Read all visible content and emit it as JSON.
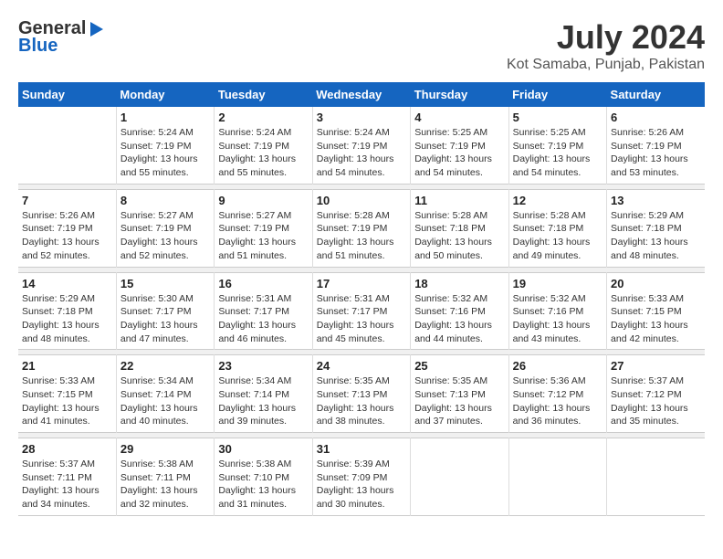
{
  "header": {
    "logo_general": "General",
    "logo_blue": "Blue",
    "title": "July 2024",
    "location": "Kot Samaba, Punjab, Pakistan"
  },
  "weekdays": [
    "Sunday",
    "Monday",
    "Tuesday",
    "Wednesday",
    "Thursday",
    "Friday",
    "Saturday"
  ],
  "weeks": [
    [
      {
        "day": "",
        "info": ""
      },
      {
        "day": "1",
        "info": "Sunrise: 5:24 AM\nSunset: 7:19 PM\nDaylight: 13 hours\nand 55 minutes."
      },
      {
        "day": "2",
        "info": "Sunrise: 5:24 AM\nSunset: 7:19 PM\nDaylight: 13 hours\nand 55 minutes."
      },
      {
        "day": "3",
        "info": "Sunrise: 5:24 AM\nSunset: 7:19 PM\nDaylight: 13 hours\nand 54 minutes."
      },
      {
        "day": "4",
        "info": "Sunrise: 5:25 AM\nSunset: 7:19 PM\nDaylight: 13 hours\nand 54 minutes."
      },
      {
        "day": "5",
        "info": "Sunrise: 5:25 AM\nSunset: 7:19 PM\nDaylight: 13 hours\nand 54 minutes."
      },
      {
        "day": "6",
        "info": "Sunrise: 5:26 AM\nSunset: 7:19 PM\nDaylight: 13 hours\nand 53 minutes."
      }
    ],
    [
      {
        "day": "7",
        "info": "Sunrise: 5:26 AM\nSunset: 7:19 PM\nDaylight: 13 hours\nand 52 minutes."
      },
      {
        "day": "8",
        "info": "Sunrise: 5:27 AM\nSunset: 7:19 PM\nDaylight: 13 hours\nand 52 minutes."
      },
      {
        "day": "9",
        "info": "Sunrise: 5:27 AM\nSunset: 7:19 PM\nDaylight: 13 hours\nand 51 minutes."
      },
      {
        "day": "10",
        "info": "Sunrise: 5:28 AM\nSunset: 7:19 PM\nDaylight: 13 hours\nand 51 minutes."
      },
      {
        "day": "11",
        "info": "Sunrise: 5:28 AM\nSunset: 7:18 PM\nDaylight: 13 hours\nand 50 minutes."
      },
      {
        "day": "12",
        "info": "Sunrise: 5:28 AM\nSunset: 7:18 PM\nDaylight: 13 hours\nand 49 minutes."
      },
      {
        "day": "13",
        "info": "Sunrise: 5:29 AM\nSunset: 7:18 PM\nDaylight: 13 hours\nand 48 minutes."
      }
    ],
    [
      {
        "day": "14",
        "info": "Sunrise: 5:29 AM\nSunset: 7:18 PM\nDaylight: 13 hours\nand 48 minutes."
      },
      {
        "day": "15",
        "info": "Sunrise: 5:30 AM\nSunset: 7:17 PM\nDaylight: 13 hours\nand 47 minutes."
      },
      {
        "day": "16",
        "info": "Sunrise: 5:31 AM\nSunset: 7:17 PM\nDaylight: 13 hours\nand 46 minutes."
      },
      {
        "day": "17",
        "info": "Sunrise: 5:31 AM\nSunset: 7:17 PM\nDaylight: 13 hours\nand 45 minutes."
      },
      {
        "day": "18",
        "info": "Sunrise: 5:32 AM\nSunset: 7:16 PM\nDaylight: 13 hours\nand 44 minutes."
      },
      {
        "day": "19",
        "info": "Sunrise: 5:32 AM\nSunset: 7:16 PM\nDaylight: 13 hours\nand 43 minutes."
      },
      {
        "day": "20",
        "info": "Sunrise: 5:33 AM\nSunset: 7:15 PM\nDaylight: 13 hours\nand 42 minutes."
      }
    ],
    [
      {
        "day": "21",
        "info": "Sunrise: 5:33 AM\nSunset: 7:15 PM\nDaylight: 13 hours\nand 41 minutes."
      },
      {
        "day": "22",
        "info": "Sunrise: 5:34 AM\nSunset: 7:14 PM\nDaylight: 13 hours\nand 40 minutes."
      },
      {
        "day": "23",
        "info": "Sunrise: 5:34 AM\nSunset: 7:14 PM\nDaylight: 13 hours\nand 39 minutes."
      },
      {
        "day": "24",
        "info": "Sunrise: 5:35 AM\nSunset: 7:13 PM\nDaylight: 13 hours\nand 38 minutes."
      },
      {
        "day": "25",
        "info": "Sunrise: 5:35 AM\nSunset: 7:13 PM\nDaylight: 13 hours\nand 37 minutes."
      },
      {
        "day": "26",
        "info": "Sunrise: 5:36 AM\nSunset: 7:12 PM\nDaylight: 13 hours\nand 36 minutes."
      },
      {
        "day": "27",
        "info": "Sunrise: 5:37 AM\nSunset: 7:12 PM\nDaylight: 13 hours\nand 35 minutes."
      }
    ],
    [
      {
        "day": "28",
        "info": "Sunrise: 5:37 AM\nSunset: 7:11 PM\nDaylight: 13 hours\nand 34 minutes."
      },
      {
        "day": "29",
        "info": "Sunrise: 5:38 AM\nSunset: 7:11 PM\nDaylight: 13 hours\nand 32 minutes."
      },
      {
        "day": "30",
        "info": "Sunrise: 5:38 AM\nSunset: 7:10 PM\nDaylight: 13 hours\nand 31 minutes."
      },
      {
        "day": "31",
        "info": "Sunrise: 5:39 AM\nSunset: 7:09 PM\nDaylight: 13 hours\nand 30 minutes."
      },
      {
        "day": "",
        "info": ""
      },
      {
        "day": "",
        "info": ""
      },
      {
        "day": "",
        "info": ""
      }
    ]
  ]
}
